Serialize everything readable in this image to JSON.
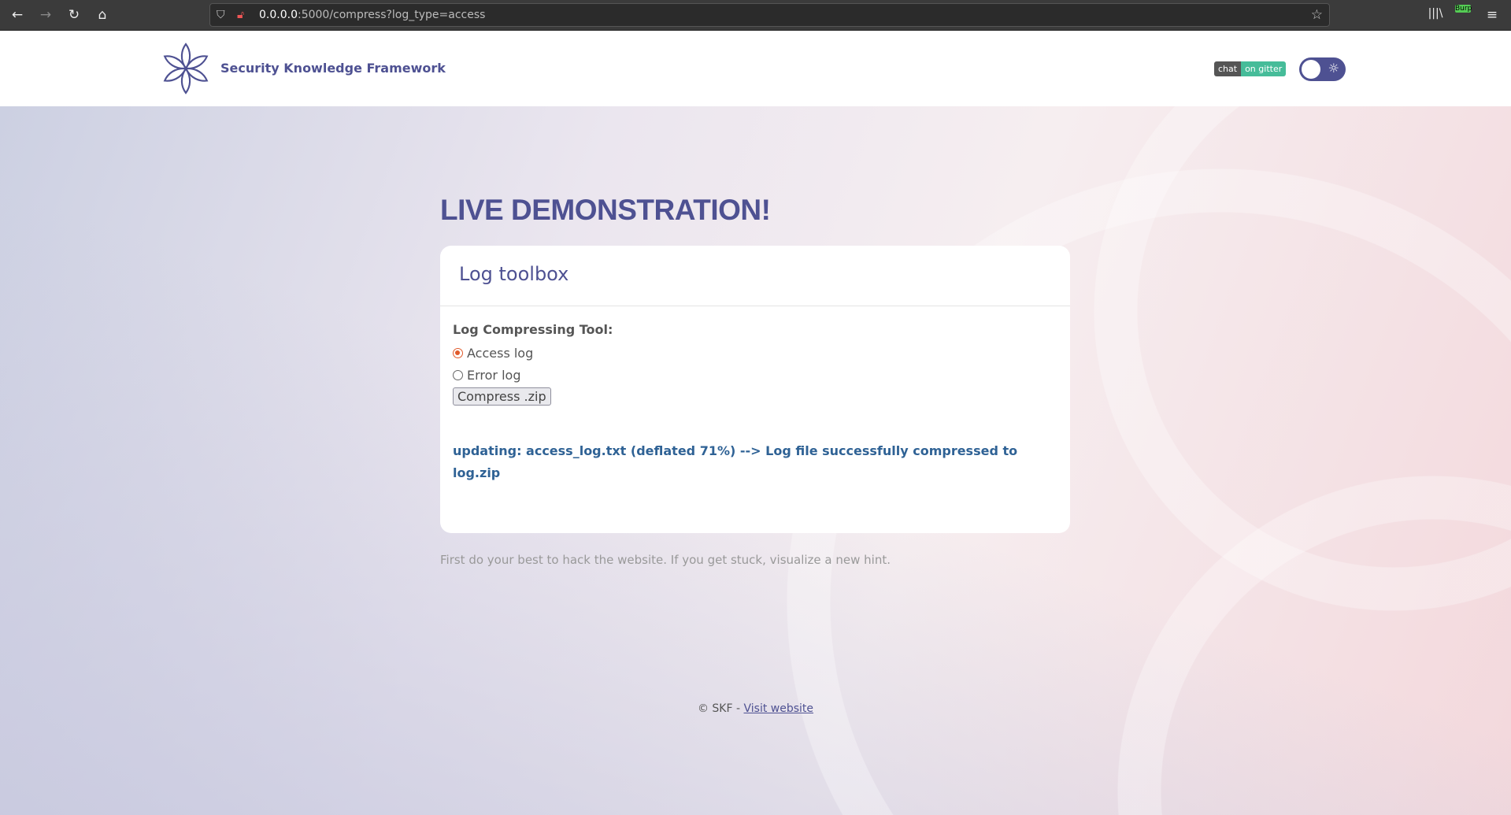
{
  "browser": {
    "url_host": "0.0.0.0",
    "url_rest": ":5000/compress?log_type=access",
    "ext_label": "Burp"
  },
  "header": {
    "brand": "Security Knowledge Framework",
    "badge_left": "chat",
    "badge_right": "on gitter"
  },
  "main": {
    "heading": "LIVE DEMONSTRATION!",
    "card_title": "Log toolbox",
    "tool_label": "Log Compressing Tool:",
    "options": [
      {
        "label": "Access log",
        "checked": true
      },
      {
        "label": "Error log",
        "checked": false
      }
    ],
    "button": "Compress .zip",
    "result": "updating: access_log.txt (deflated 71%) --> Log file successfully compressed to log.zip",
    "hint": "First do your best to hack the website. If you get stuck, visualize a new hint."
  },
  "footer": {
    "copyright": "© SKF -",
    "link": "Visit website"
  },
  "colors": {
    "brand": "#4e5192",
    "accent": "#e05a2b",
    "result": "#2f6295"
  }
}
